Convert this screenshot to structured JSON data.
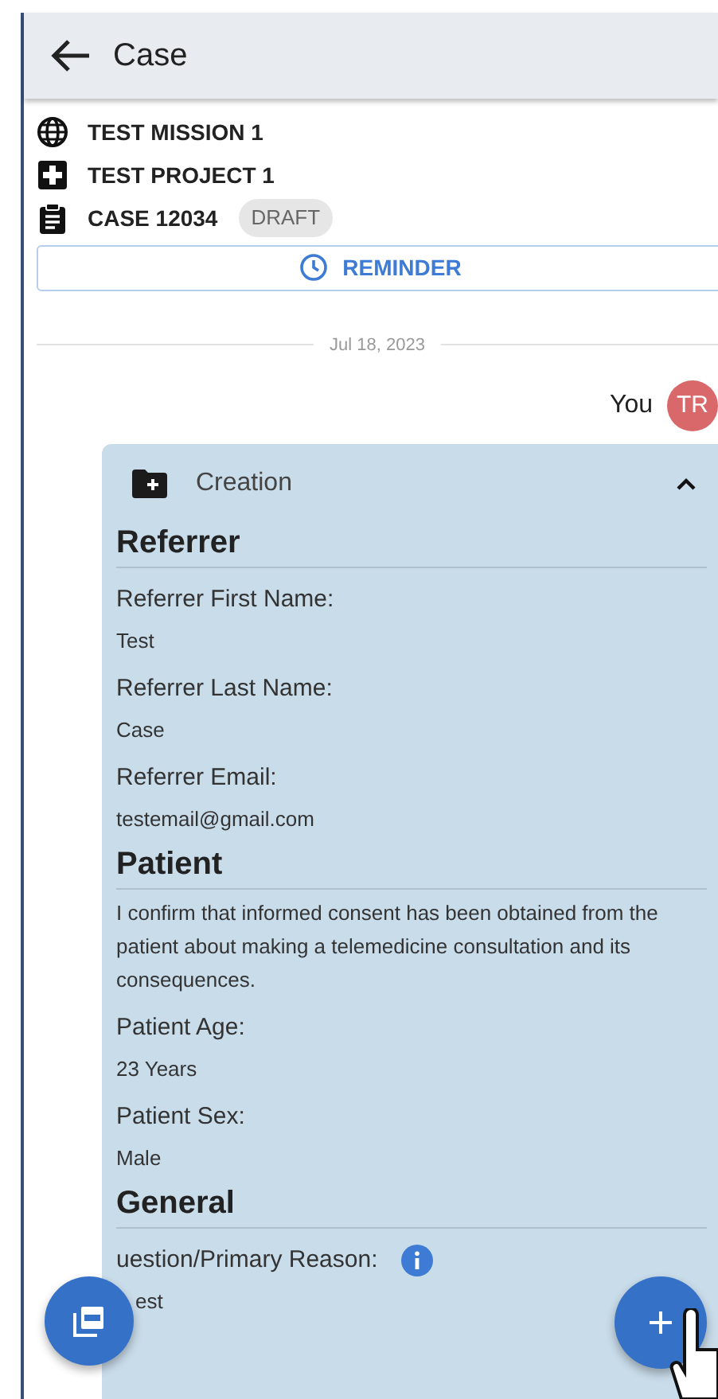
{
  "app_bar": {
    "title": "Case"
  },
  "meta": [
    {
      "kind": "mission",
      "text": "TEST MISSION 1"
    },
    {
      "kind": "project",
      "text": "TEST PROJECT 1"
    },
    {
      "kind": "case",
      "text": "CASE 12034",
      "badge": "DRAFT"
    }
  ],
  "reminder_button": "REMINDER",
  "date_divider": "Jul 18, 2023",
  "sender": {
    "name": "You",
    "initials": "TR"
  },
  "card": {
    "title": "Creation",
    "expanded": true,
    "sections": [
      {
        "heading": "Referrer",
        "items": [
          {
            "kind": "field",
            "label": "Referrer First Name:",
            "value": "Test"
          },
          {
            "kind": "field",
            "label": "Referrer Last Name:",
            "value": "Case"
          },
          {
            "kind": "field",
            "label": "Referrer Email:",
            "value": "testemail@gmail.com"
          }
        ]
      },
      {
        "heading": "Patient",
        "items": [
          {
            "kind": "statement",
            "text": "I confirm that informed consent has been obtained from the patient about making a telemedicine consultation and its consequences."
          },
          {
            "kind": "field",
            "label": "Patient Age:",
            "value": "23 Years"
          },
          {
            "kind": "field",
            "label": "Patient Sex:",
            "value": "Male"
          }
        ]
      },
      {
        "heading": "General",
        "items": [
          {
            "kind": "field",
            "label": "uestion/Primary Reason:",
            "value": "est",
            "info": true
          }
        ]
      }
    ]
  }
}
